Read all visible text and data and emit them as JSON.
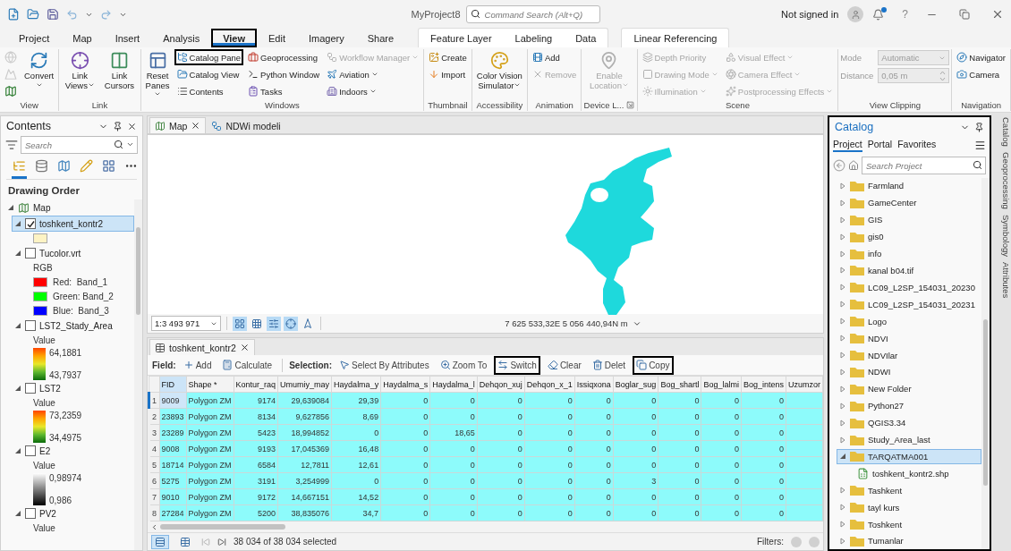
{
  "title_bar": {
    "title": "MyProject8",
    "search": {
      "placeholder": "Command Search (Alt+Q)"
    },
    "account": "Not signed in",
    "help": "?"
  },
  "ribbon_tabs": [
    {
      "label": "Project",
      "selected": false,
      "highlighted": false
    },
    {
      "label": "Map",
      "selected": false,
      "highlighted": false
    },
    {
      "label": "Insert",
      "selected": false,
      "highlighted": false
    },
    {
      "label": "Analysis",
      "selected": false,
      "highlighted": false
    },
    {
      "label": "View",
      "selected": true,
      "highlighted": true
    },
    {
      "label": "Edit",
      "selected": false,
      "highlighted": false
    },
    {
      "label": "Imagery",
      "selected": false,
      "highlighted": false
    },
    {
      "label": "Share",
      "selected": false,
      "highlighted": false
    }
  ],
  "contextual_tab_groups": [
    [
      {
        "label": "Feature Layer",
        "selected": false,
        "highlighted": false
      },
      {
        "label": "Labeling",
        "selected": false,
        "highlighted": false
      },
      {
        "label": "Data",
        "selected": false,
        "highlighted": false
      }
    ],
    [
      {
        "label": "Linear Referencing",
        "selected": false,
        "highlighted": false
      }
    ]
  ],
  "ribbon_groups": [
    {
      "label": "View",
      "launcher": false,
      "controls": [
        {
          "kind": "icon",
          "disabled": true,
          "dropdown": false,
          "highlighted": false
        },
        {
          "kind": "icon",
          "disabled": true,
          "dropdown": false,
          "highlighted": false
        },
        {
          "kind": "icon",
          "disabled": false,
          "dropdown": false,
          "highlighted": false
        },
        {
          "kind": "large",
          "label": "Convert",
          "disabled": false,
          "dropdown": true,
          "highlighted": false
        }
      ]
    },
    {
      "label": "Link",
      "launcher": false,
      "controls": [
        {
          "kind": "large",
          "label": "Link Views",
          "disabled": false,
          "dropdown": true,
          "highlighted": false
        },
        {
          "kind": "large",
          "label": "Link Cursors",
          "disabled": false,
          "dropdown": false,
          "highlighted": false
        }
      ]
    },
    {
      "label": "Windows",
      "launcher": false,
      "controls": [
        {
          "kind": "large",
          "label": "Reset Panes",
          "disabled": false,
          "dropdown": true,
          "highlighted": false
        },
        {
          "kind": "small",
          "label": "Catalog Pane",
          "disabled": false,
          "dropdown": false,
          "highlighted": true
        },
        {
          "kind": "small",
          "label": "Catalog View",
          "disabled": false,
          "dropdown": false,
          "highlighted": false
        },
        {
          "kind": "small",
          "label": "Contents",
          "disabled": false,
          "dropdown": false,
          "highlighted": false
        },
        {
          "kind": "small",
          "label": "Geoprocessing",
          "disabled": false,
          "dropdown": false,
          "highlighted": false
        },
        {
          "kind": "small",
          "label": "Python Window",
          "disabled": false,
          "dropdown": false,
          "highlighted": false
        },
        {
          "kind": "small",
          "label": "Tasks",
          "disabled": false,
          "dropdown": false,
          "highlighted": false
        },
        {
          "kind": "small",
          "label": "Workflow Manager",
          "disabled": true,
          "dropdown": true,
          "highlighted": false
        },
        {
          "kind": "small",
          "label": "Aviation",
          "disabled": false,
          "dropdown": true,
          "highlighted": false
        },
        {
          "kind": "small",
          "label": "Indoors",
          "disabled": false,
          "dropdown": true,
          "highlighted": false
        }
      ]
    },
    {
      "label": "Thumbnail",
      "launcher": false,
      "controls": [
        {
          "kind": "small",
          "label": "Create",
          "disabled": false,
          "dropdown": false,
          "highlighted": false
        },
        {
          "kind": "small",
          "label": "Import",
          "disabled": false,
          "dropdown": false,
          "highlighted": false
        }
      ]
    },
    {
      "label": "Accessibility",
      "launcher": false,
      "controls": [
        {
          "kind": "large",
          "label": "Color Vision Simulator",
          "disabled": false,
          "dropdown": true,
          "highlighted": false
        }
      ]
    },
    {
      "label": "Animation",
      "launcher": false,
      "controls": [
        {
          "kind": "small",
          "label": "Add",
          "disabled": false,
          "dropdown": false,
          "highlighted": false
        },
        {
          "kind": "small",
          "label": "Remove",
          "disabled": true,
          "dropdown": false,
          "highlighted": false
        }
      ]
    },
    {
      "label": "Device L...",
      "launcher": true,
      "controls": [
        {
          "kind": "large",
          "label": "Enable Location",
          "disabled": true,
          "dropdown": true,
          "highlighted": false
        }
      ]
    },
    {
      "label": "Scene",
      "launcher": false,
      "controls": [
        {
          "kind": "small",
          "label": "Depth Priority",
          "disabled": true,
          "dropdown": false,
          "highlighted": false
        },
        {
          "kind": "small",
          "label": "Drawing Mode",
          "disabled": true,
          "dropdown": true,
          "highlighted": false
        },
        {
          "kind": "small",
          "label": "Illumination",
          "disabled": true,
          "dropdown": true,
          "highlighted": false
        },
        {
          "kind": "small",
          "label": "Visual Effect",
          "disabled": true,
          "dropdown": true,
          "highlighted": false
        },
        {
          "kind": "small",
          "label": "Camera Effect",
          "disabled": true,
          "dropdown": true,
          "highlighted": false
        },
        {
          "kind": "small",
          "label": "Postprocessing Effects",
          "disabled": true,
          "dropdown": true,
          "highlighted": false
        }
      ]
    },
    {
      "label": "View Clipping",
      "launcher": false,
      "controls": [
        {
          "kind": "select",
          "label": "Mode",
          "value": "Automatic",
          "disabled": true,
          "dropdown": true,
          "highlighted": false
        },
        {
          "kind": "spin",
          "label": "Distance",
          "value": "0,05  m",
          "disabled": true,
          "dropdown": false,
          "highlighted": false
        }
      ]
    },
    {
      "label": "Navigation",
      "launcher": false,
      "controls": [
        {
          "kind": "small",
          "label": "Navigator",
          "disabled": false,
          "dropdown": false,
          "highlighted": false
        },
        {
          "kind": "small",
          "label": "Camera",
          "disabled": false,
          "dropdown": false,
          "highlighted": false
        }
      ]
    }
  ],
  "contents": {
    "title": "Contents",
    "search": {
      "placeholder": "Search"
    },
    "views": [
      {
        "selected": true
      },
      {
        "selected": false
      },
      {
        "selected": false
      },
      {
        "selected": false
      },
      {
        "selected": false
      },
      {
        "selected": false
      }
    ],
    "heading": "Drawing Order",
    "map": {
      "label": "Map",
      "expanded": true,
      "layers": [
        {
          "label": "toshkent_kontr2",
          "expanded": true,
          "checked": true,
          "selected": true,
          "legend": {
            "kind": "swatch",
            "color": "#fdf3c4"
          }
        },
        {
          "label": "Tucolor.vrt",
          "expanded": true,
          "checked": false,
          "selected": false,
          "legend": {
            "kind": "rgb",
            "title": "RGB",
            "entries": [
              {
                "label": "Red:  Band_1",
                "color": "#ff0000"
              },
              {
                "label": "Green: Band_2",
                "color": "#00ff00"
              },
              {
                "label": "Blue:  Band_3",
                "color": "#0000ff"
              }
            ]
          }
        },
        {
          "label": "LST2_Stady_Area",
          "expanded": true,
          "checked": false,
          "selected": false,
          "legend": {
            "kind": "heat",
            "title": "Value",
            "high": "64,1881",
            "low": "43,7937"
          }
        },
        {
          "label": "LST2",
          "expanded": true,
          "checked": false,
          "selected": false,
          "legend": {
            "kind": "heat",
            "title": "Value",
            "high": "73,2359",
            "low": "34,4975"
          }
        },
        {
          "label": "E2",
          "expanded": true,
          "checked": false,
          "selected": false,
          "legend": {
            "kind": "gray",
            "title": "Value",
            "high": "0,98974",
            "low": "0,986"
          }
        },
        {
          "label": "PV2",
          "expanded": true,
          "checked": false,
          "selected": false,
          "legend": {
            "kind": "title",
            "title": "Value"
          }
        }
      ]
    }
  },
  "map_tabs": [
    {
      "kind": "map",
      "label": "Map",
      "selected": true,
      "closable": true
    },
    {
      "kind": "model",
      "label": "NDWi modeli",
      "selected": false,
      "closable": false
    }
  ],
  "map_status": {
    "scale": "1:3 493 971",
    "toggles": [
      {
        "on": true
      },
      {
        "on": false
      },
      {
        "on": true
      },
      {
        "on": true
      },
      {
        "on": false
      }
    ],
    "coordinates": "7 625 533,32E 5 056 440,94N m"
  },
  "attribute_table": {
    "tab": {
      "label": "toshkent_kontr2",
      "closable": true
    },
    "field_label": "Field:",
    "field_tools": [
      {
        "label": "Add",
        "highlighted": false
      },
      {
        "label": "Calculate",
        "highlighted": false
      }
    ],
    "selection_label": "Selection:",
    "selection_tools": [
      {
        "label": "Select By Attributes",
        "highlighted": false
      },
      {
        "label": "Zoom To",
        "highlighted": false
      },
      {
        "label": "Switch",
        "highlighted": true
      },
      {
        "label": "Clear",
        "highlighted": false
      },
      {
        "label": "Delet",
        "highlighted": false
      },
      {
        "label": "Copy",
        "highlighted": true
      }
    ],
    "columns": [
      {
        "label": "FID",
        "selected": true
      },
      {
        "label": "Shape *",
        "selected": false
      },
      {
        "label": "Kontur_raq",
        "selected": false
      },
      {
        "label": "Umumiy_may",
        "selected": false
      },
      {
        "label": "Haydalma_y",
        "selected": false
      },
      {
        "label": "Haydalma_s",
        "selected": false
      },
      {
        "label": "Haydalma_l",
        "selected": false
      },
      {
        "label": "Dehqon_xuj",
        "selected": false
      },
      {
        "label": "Dehqon_x_1",
        "selected": false
      },
      {
        "label": "Issiqxona",
        "selected": false
      },
      {
        "label": "Boglar_sug",
        "selected": false
      },
      {
        "label": "Bog_shartl",
        "selected": false
      },
      {
        "label": "Bog_lalmi",
        "selected": false
      },
      {
        "label": "Bog_intens",
        "selected": false
      },
      {
        "label": "Uzumzor",
        "selected": false
      }
    ],
    "rows": [
      {
        "number": "1",
        "selected": true,
        "active": true,
        "cells": [
          "9009",
          "Polygon ZM",
          "9174",
          "29,639084",
          "29,39",
          "0",
          "0",
          "0",
          "0",
          "0",
          "0",
          "0",
          "0",
          "0"
        ]
      },
      {
        "number": "2",
        "selected": true,
        "active": false,
        "cells": [
          "23893",
          "Polygon ZM",
          "8134",
          "9,627856",
          "8,69",
          "0",
          "0",
          "0",
          "0",
          "0",
          "0",
          "0",
          "0",
          "0"
        ]
      },
      {
        "number": "3",
        "selected": true,
        "active": false,
        "cells": [
          "23289",
          "Polygon ZM",
          "5423",
          "18,994852",
          "0",
          "0",
          "18,65",
          "0",
          "0",
          "0",
          "0",
          "0",
          "0",
          "0"
        ]
      },
      {
        "number": "4",
        "selected": true,
        "active": false,
        "cells": [
          "9008",
          "Polygon ZM",
          "9193",
          "17,045369",
          "16,48",
          "0",
          "0",
          "0",
          "0",
          "0",
          "0",
          "0",
          "0",
          "0"
        ]
      },
      {
        "number": "5",
        "selected": true,
        "active": false,
        "cells": [
          "18714",
          "Polygon ZM",
          "6584",
          "12,7811",
          "12,61",
          "0",
          "0",
          "0",
          "0",
          "0",
          "0",
          "0",
          "0",
          "0"
        ]
      },
      {
        "number": "6",
        "selected": true,
        "active": false,
        "cells": [
          "5275",
          "Polygon ZM",
          "3191",
          "3,254999",
          "0",
          "0",
          "0",
          "0",
          "0",
          "0",
          "3",
          "0",
          "0",
          "0"
        ]
      },
      {
        "number": "7",
        "selected": true,
        "active": false,
        "cells": [
          "9010",
          "Polygon ZM",
          "9172",
          "14,667151",
          "14,52",
          "0",
          "0",
          "0",
          "0",
          "0",
          "0",
          "0",
          "0",
          "0"
        ]
      },
      {
        "number": "8",
        "selected": true,
        "active": false,
        "cells": [
          "27284",
          "Polygon ZM",
          "5200",
          "38,835076",
          "34,7",
          "0",
          "0",
          "0",
          "0",
          "0",
          "0",
          "0",
          "0",
          "0"
        ]
      }
    ],
    "status": "38 034 of 38 034 selected",
    "filters_label": "Filters:"
  },
  "catalog": {
    "title": "Catalog",
    "highlighted": true,
    "tabs": [
      {
        "label": "Project",
        "selected": true
      },
      {
        "label": "Portal",
        "selected": false
      },
      {
        "label": "Favorites",
        "selected": false
      }
    ],
    "search": {
      "placeholder": "Search Project"
    },
    "items": [
      {
        "kind": "folder",
        "label": "Farmland",
        "expanded": false,
        "selected": false
      },
      {
        "kind": "folder",
        "label": "GameCenter",
        "expanded": false,
        "selected": false
      },
      {
        "kind": "folder",
        "label": "GIS",
        "expanded": false,
        "selected": false
      },
      {
        "kind": "folder",
        "label": "gis0",
        "expanded": false,
        "selected": false
      },
      {
        "kind": "folder",
        "label": "info",
        "expanded": false,
        "selected": false
      },
      {
        "kind": "folder",
        "label": "kanal b04.tif",
        "expanded": false,
        "selected": false
      },
      {
        "kind": "folder",
        "label": "LC09_L2SP_154031_20230",
        "expanded": false,
        "selected": false
      },
      {
        "kind": "folder",
        "label": "LC09_L2SP_154031_20231",
        "expanded": false,
        "selected": false
      },
      {
        "kind": "folder",
        "label": "Logo",
        "expanded": false,
        "selected": false
      },
      {
        "kind": "folder",
        "label": "NDVI",
        "expanded": false,
        "selected": false
      },
      {
        "kind": "folder",
        "label": "NDVIlar",
        "expanded": false,
        "selected": false
      },
      {
        "kind": "folder",
        "label": "NDWI",
        "expanded": false,
        "selected": false
      },
      {
        "kind": "folder",
        "label": "New Folder",
        "expanded": false,
        "selected": false
      },
      {
        "kind": "folder",
        "label": "Python27",
        "expanded": false,
        "selected": false
      },
      {
        "kind": "folder",
        "label": "QGIS3.34",
        "expanded": false,
        "selected": false
      },
      {
        "kind": "folder",
        "label": "Study_Area_last",
        "expanded": false,
        "selected": false
      },
      {
        "kind": "folder",
        "label": "TARQATMA001",
        "expanded": true,
        "selected": true,
        "children": [
          {
            "kind": "shapefile",
            "label": "toshkent_kontr2.shp",
            "selected": false
          }
        ]
      },
      {
        "kind": "folder",
        "label": "Tashkent",
        "expanded": false,
        "selected": false
      },
      {
        "kind": "folder",
        "label": "tayl kurs",
        "expanded": false,
        "selected": false
      },
      {
        "kind": "folder",
        "label": "Toshkent",
        "expanded": false,
        "selected": false
      },
      {
        "kind": "folder",
        "label": "Tumanlar",
        "expanded": false,
        "selected": false
      }
    ]
  },
  "side_tabs": [
    "Catalog",
    "Geoprocessing",
    "Symbology",
    "Attributes"
  ]
}
